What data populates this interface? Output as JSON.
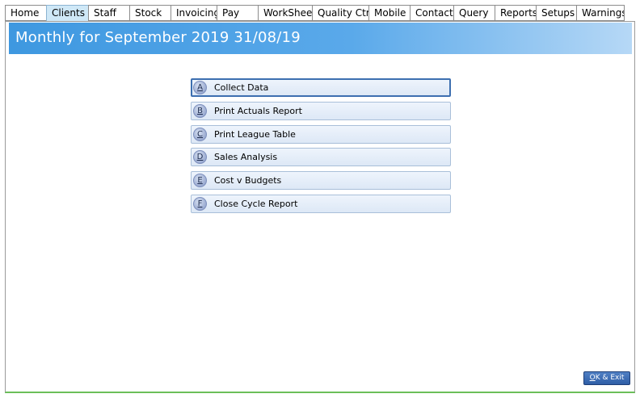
{
  "tabs": [
    {
      "label": "Home",
      "active": false
    },
    {
      "label": "Clients",
      "active": true
    },
    {
      "label": "Staff",
      "active": false
    },
    {
      "label": "Stock",
      "active": false
    },
    {
      "label": "Invoicing",
      "active": false
    },
    {
      "label": "Pay",
      "active": false
    },
    {
      "label": "WorkSheet",
      "active": false
    },
    {
      "label": "Quality Ctrl",
      "active": false
    },
    {
      "label": "Mobile",
      "active": false
    },
    {
      "label": "Contacts",
      "active": false
    },
    {
      "label": "Query",
      "active": false
    },
    {
      "label": "Reports",
      "active": false
    },
    {
      "label": "Setups",
      "active": false
    },
    {
      "label": "Warnings",
      "active": false
    }
  ],
  "header": {
    "title": "Monthly for September 2019 31/08/19"
  },
  "menu": {
    "items": [
      {
        "key": "A",
        "label": "Collect Data"
      },
      {
        "key": "B",
        "label": "Print Actuals Report"
      },
      {
        "key": "C",
        "label": "Print League Table"
      },
      {
        "key": "D",
        "label": "Sales Analysis"
      },
      {
        "key": "E",
        "label": "Cost v Budgets"
      },
      {
        "key": "F",
        "label": "Close Cycle Report"
      }
    ]
  },
  "footer": {
    "ok_key": "O",
    "ok_rest": "K & Exit"
  },
  "colors": {
    "header_start": "#3e98e0",
    "header_end": "#b6d8f6",
    "active_tab": "#cfe8f7",
    "ok_button": "#2f5ea6",
    "frame_bottom": "#6bbf59"
  }
}
